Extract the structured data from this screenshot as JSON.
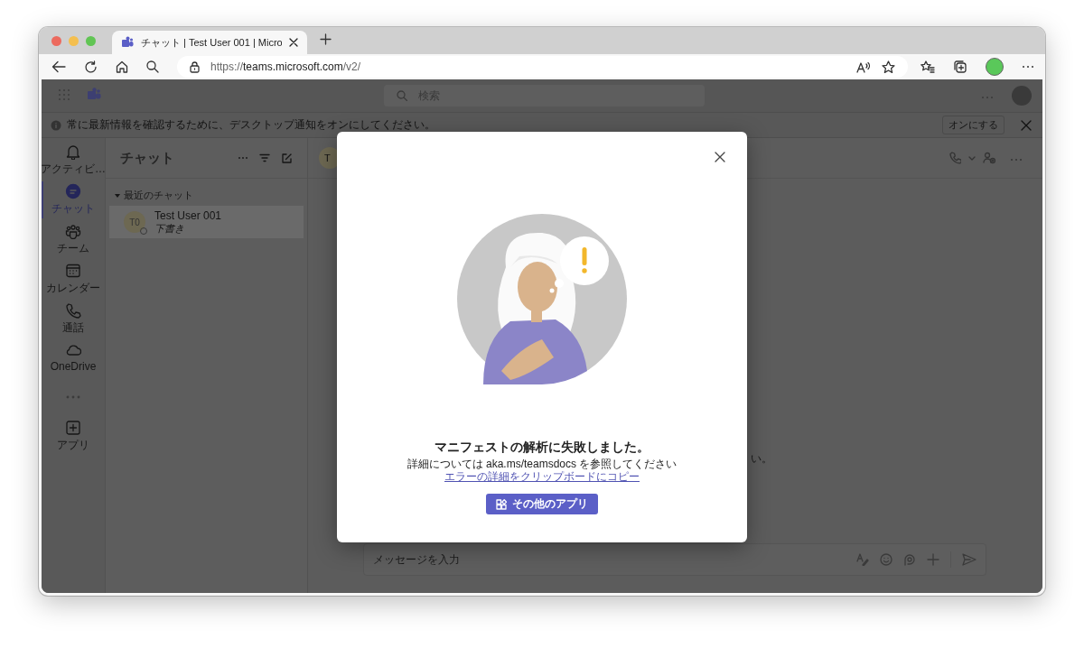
{
  "browser": {
    "tab": {
      "title": "チャット | Test User 001 | Micro",
      "selected": true
    },
    "url": {
      "scheme": "https://",
      "host": "teams.microsoft.com",
      "path": "/v2/"
    }
  },
  "teams": {
    "search": {
      "placeholder": "検索"
    },
    "banner": {
      "text": "常に最新情報を確認するために、デスクトップ通知をオンにしてください。",
      "button": "オンにする"
    },
    "rail": [
      {
        "label": "アクティビ…",
        "selected": false
      },
      {
        "label": "チャット",
        "selected": true
      },
      {
        "label": "チーム",
        "selected": false
      },
      {
        "label": "カレンダー",
        "selected": false
      },
      {
        "label": "通話",
        "selected": false
      },
      {
        "label": "OneDrive",
        "selected": false
      },
      {
        "label": "アプリ",
        "selected": false
      }
    ],
    "chat_list": {
      "title": "チャット",
      "section": "最近のチャット",
      "items": [
        {
          "initials": "T0",
          "name": "Test User 001",
          "preview": "下書き",
          "selected": true
        }
      ]
    },
    "conversation": {
      "initials": "T",
      "partial_text": "い。",
      "composer": {
        "placeholder": "メッセージを入力"
      }
    }
  },
  "dialog": {
    "title": "マニフェストの解析に失敗しました。",
    "detail": "詳細については aka.ms/teamsdocs を参照してください",
    "link": "エラーの詳細をクリップボードにコピー",
    "button": "その他のアプリ"
  }
}
